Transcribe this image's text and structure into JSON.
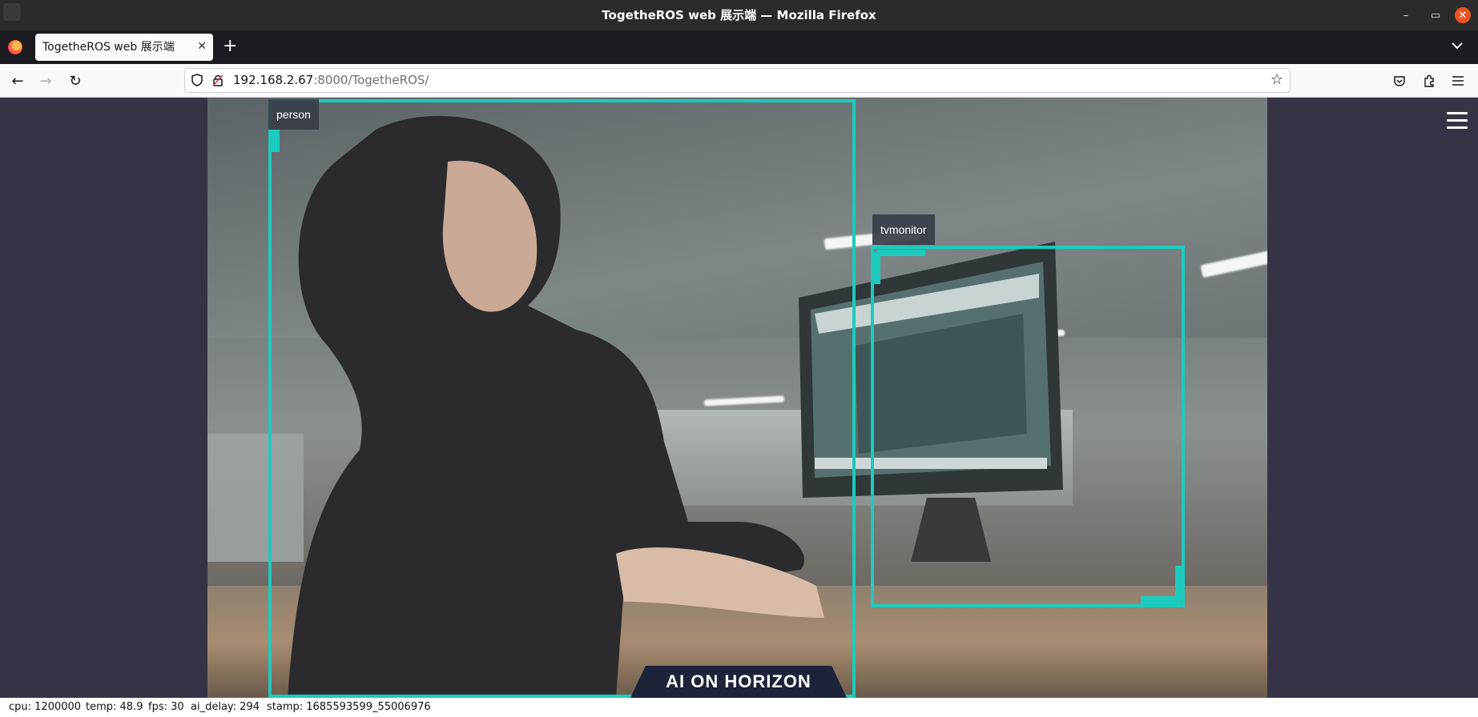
{
  "window": {
    "title": "TogetheROS web 展示端 — Mozilla Firefox",
    "minimize": "–",
    "maximize": "▭",
    "close": "✕"
  },
  "tabs": [
    {
      "label": "TogetheROS web 展示端",
      "close": "✕"
    }
  ],
  "tabbar": {
    "new_tab": "+",
    "list_all": "⌄"
  },
  "navbar": {
    "back": "←",
    "forward": "→",
    "reload": "↻",
    "url_host": "192.168.2.67",
    "url_path": ":8000/TogetheROS/",
    "bookmark": "☆",
    "pocket": "⛉",
    "extensions": "⧉",
    "menu": "≡"
  },
  "page": {
    "detections": [
      {
        "label": "person"
      },
      {
        "label": "tvmonitor"
      }
    ],
    "brand_badge": "AI ON HORIZON"
  },
  "status": {
    "cpu": "cpu: 1200000",
    "temp": "temp: 48.9",
    "fps": "fps: 30",
    "ai_delay": "ai_delay: 294",
    "stamp": "stamp: 1685593599_55006976"
  },
  "colors": {
    "bbox": "#1ccbbd",
    "page_bg": "#373346",
    "titlebar_bg": "#2b2b2b",
    "close_button": "#e95420"
  }
}
